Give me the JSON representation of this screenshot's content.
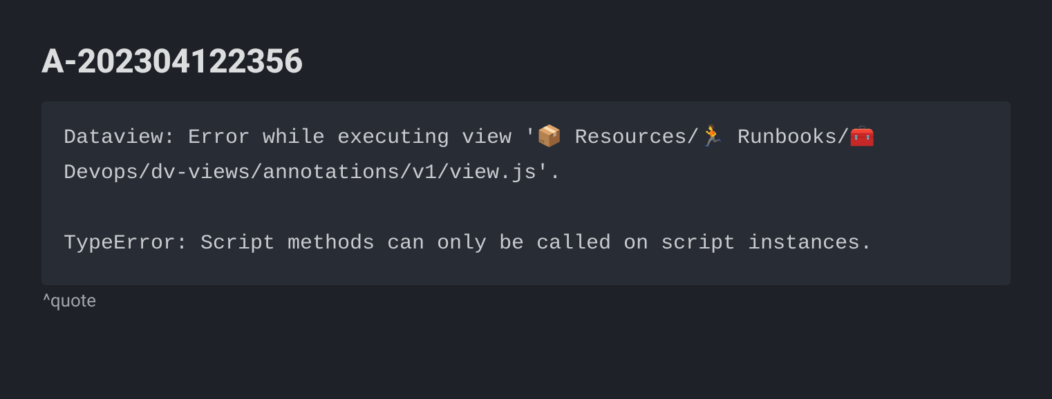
{
  "title": "A-202304122356",
  "error": {
    "line1": "Dataview: Error while executing view '📦 Resources/🏃 Runbooks/🧰 Devops/dv-views/annotations/v1/view.js'.",
    "line2": "TypeError: Script methods can only be called on script instances."
  },
  "block_ref": "^quote"
}
